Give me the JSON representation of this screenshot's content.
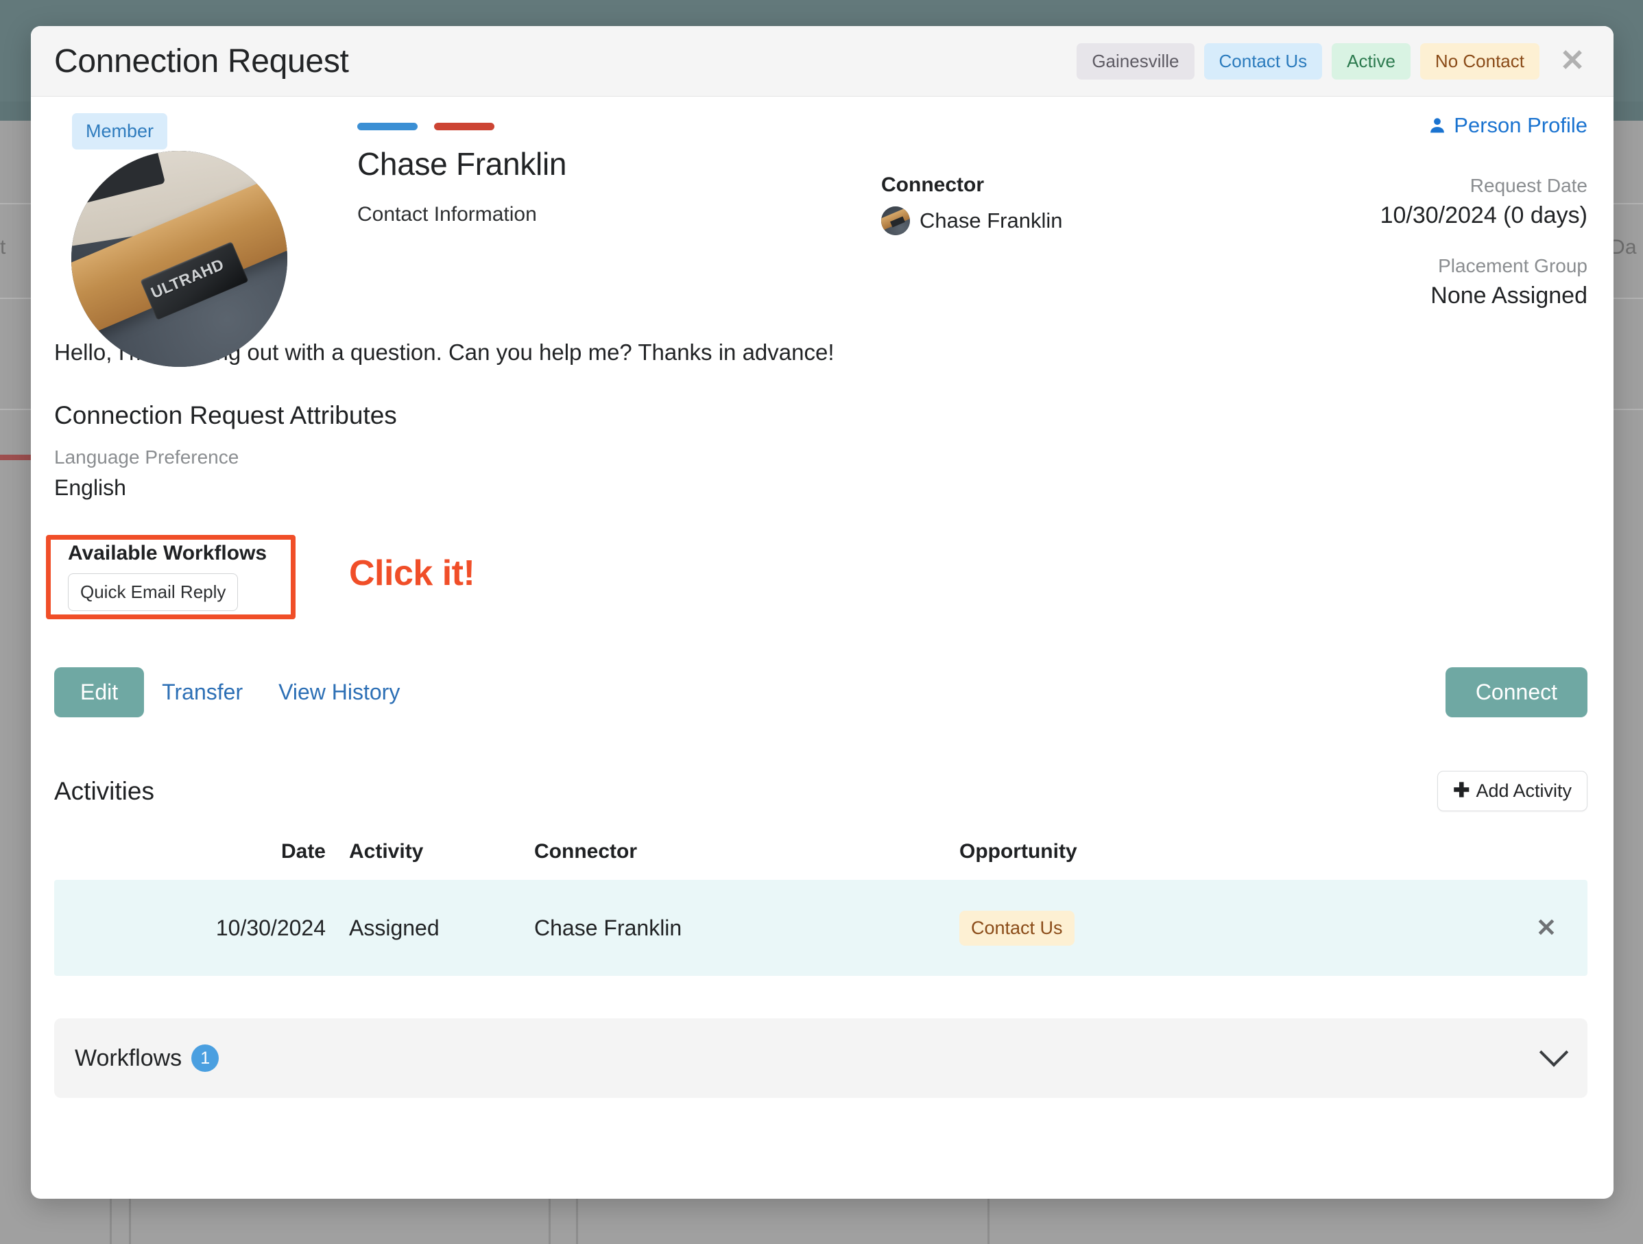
{
  "modal": {
    "title": "Connection Request",
    "header_badges": [
      {
        "label": "Gainesville",
        "style": "b-gray"
      },
      {
        "label": "Contact Us",
        "style": "b-blue"
      },
      {
        "label": "Active",
        "style": "b-green"
      },
      {
        "label": "No Contact",
        "style": "b-amber"
      }
    ],
    "close_label": "✕"
  },
  "identity": {
    "member_badge": "Member",
    "name": "Chase Franklin",
    "contact_information_label": "Contact Information",
    "accent_bar_blue": "#3b8fd4",
    "accent_bar_red": "#cc4433",
    "avatar_plate_text": "ULTRAHD"
  },
  "connector": {
    "label": "Connector",
    "name": "Chase Franklin"
  },
  "meta": {
    "person_profile_link": "Person Profile",
    "request_date_label": "Request Date",
    "request_date_value": "10/30/2024 (0 days)",
    "placement_group_label": "Placement Group",
    "placement_group_value": "None Assigned"
  },
  "message": "Hello, I'm reaching out with a question. Can you help me? Thanks in advance!",
  "attributes": {
    "section_title": "Connection Request Attributes",
    "items": [
      {
        "label": "Language Preference",
        "value": "English"
      }
    ]
  },
  "available_workflows": {
    "title": "Available Workflows",
    "chips": [
      "Quick Email Reply"
    ],
    "annotation": "Click it!",
    "highlight_color": "#f04e28"
  },
  "actions": {
    "edit": "Edit",
    "transfer": "Transfer",
    "view_history": "View History",
    "connect": "Connect",
    "primary_color": "#6fa8a3"
  },
  "activities": {
    "title": "Activities",
    "add_button": "Add Activity",
    "add_icon": "plus-icon",
    "columns": [
      "Date",
      "Activity",
      "Connector",
      "Opportunity"
    ],
    "rows": [
      {
        "date": "10/30/2024",
        "activity": "Assigned",
        "connector": "Chase Franklin",
        "opportunity": "Contact Us",
        "remove_label": "✕"
      }
    ]
  },
  "workflows_footer": {
    "title": "Workflows",
    "count": "1",
    "chevron": "chevron-down-icon"
  },
  "background": {
    "fragment_left_text": "t",
    "fragment_right_text": "Da"
  }
}
